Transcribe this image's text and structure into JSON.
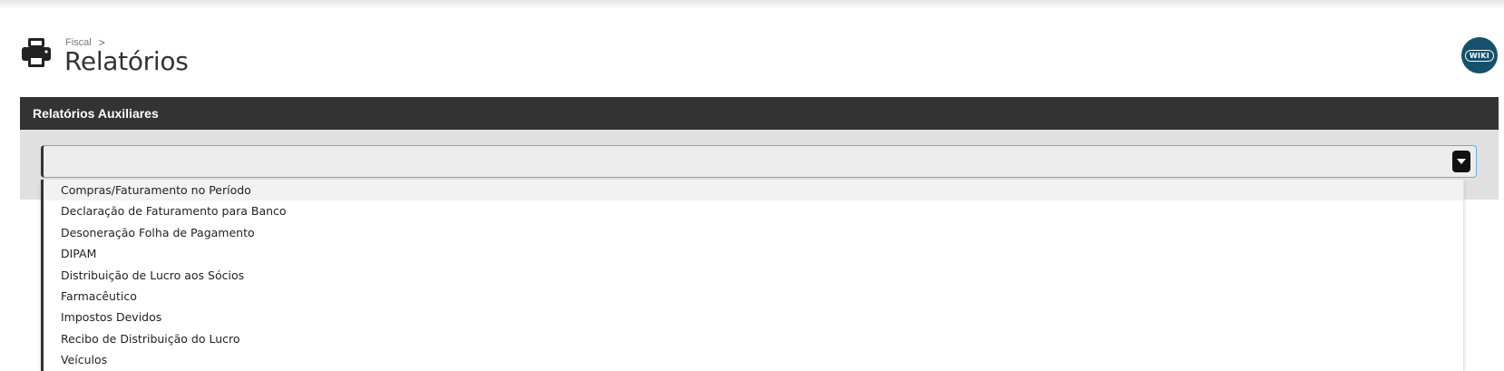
{
  "breadcrumb": {
    "parent": "Fiscal",
    "separator": ">"
  },
  "page": {
    "title": "Relatórios"
  },
  "wiki": {
    "label": "WIKI"
  },
  "section": {
    "title": "Relatórios Auxiliares"
  },
  "select": {
    "value": "",
    "options": [
      "Compras/Faturamento no Período",
      "Declaração de Faturamento para Banco",
      "Desoneração Folha de Pagamento",
      "DIPAM",
      "Distribuição de Lucro aos Sócios",
      "Farmacêutico",
      "Impostos Devidos",
      "Recibo de Distribuição do Lucro",
      "Veículos"
    ],
    "highlighted_index": 0
  },
  "icons": {
    "page_icon": "printer-icon",
    "dropdown_icon": "caret-down-icon"
  },
  "colors": {
    "header_bg": "#333333",
    "body_bg": "#e0e0e0",
    "wiki_bg": "#16506c",
    "focus_border": "#6fa8dc"
  }
}
